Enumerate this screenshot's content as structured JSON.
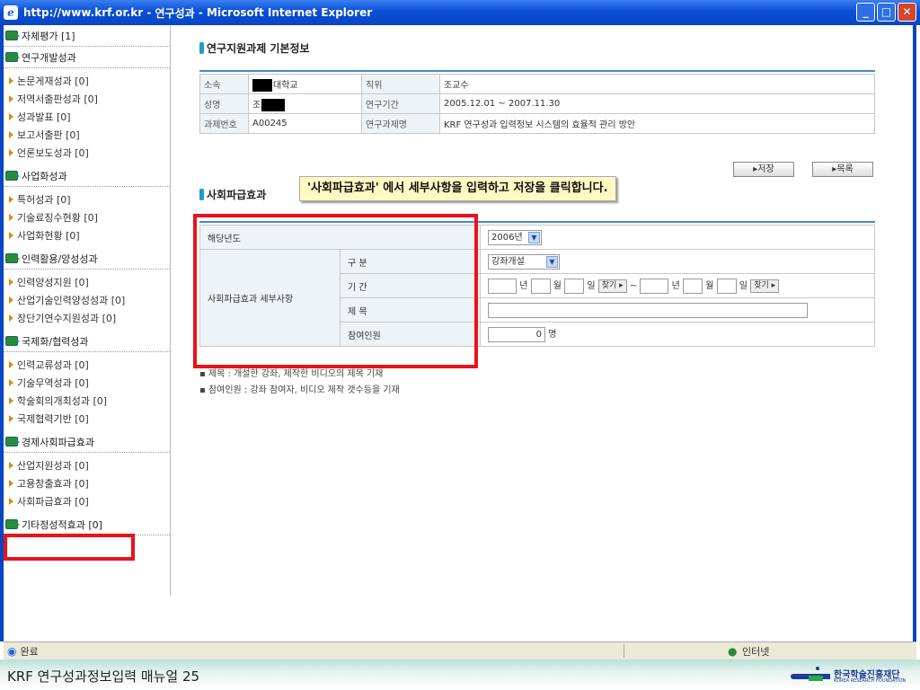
{
  "window": {
    "url": "http://www.krf.or.kr",
    "title_sep": " - ",
    "page": "연구성과",
    "app": "Microsoft Internet Explorer"
  },
  "sidebar": [
    {
      "group": "자체평가 [1]",
      "items": []
    },
    {
      "group": "연구개발성과",
      "items": [
        "논문게재성과 [0]",
        "저역서출판성과 [0]",
        "성과발표 [0]",
        "보고서출판 [0]",
        "언론보도성과 [0]"
      ]
    },
    {
      "group": "사업화성과",
      "items": [
        "특허성과 [0]",
        "기술료징수현황 [0]",
        "사업화현황 [0]"
      ]
    },
    {
      "group": "인력활용/양성성과",
      "items": [
        "인력양성지원 [0]",
        "산업기술인력양성성과 [0]",
        "장단기연수지원성과 [0]"
      ]
    },
    {
      "group": "국제화/협력성과",
      "items": [
        "인력교류성과 [0]",
        "기술무역성과 [0]",
        "학술회의개최성과 [0]",
        "국제협력기반 [0]"
      ]
    },
    {
      "group": "경제사회파급효과",
      "items": [
        "산업지원성과 [0]",
        "고용창출효과 [0]",
        "사회파급효과 [0]"
      ]
    },
    {
      "group": "기타정성적효과 [0]",
      "items": []
    }
  ],
  "basic": {
    "title": "연구지원과제 기본정보",
    "rows": [
      [
        "소속",
        "대학교",
        "직위",
        "조교수"
      ],
      [
        "성명",
        "조",
        "연구기간",
        "2005.12.01 ~ 2007.11.30"
      ],
      [
        "과제번호",
        "A00245",
        "연구과제명",
        "KRF 연구성과 입력정보 시스템의 효율적 관리 방안"
      ]
    ]
  },
  "buttons": {
    "save": "▸저장",
    "list": "▸목록",
    "find": "찾기 ▸"
  },
  "social": {
    "title": "사회파급효과",
    "callout": "'사회파급효과' 에서 세부사항을 입력하고 저장을 클릭합니다.",
    "year_label": "해당년도",
    "year_value": "2006년",
    "detail_label": "사회파급효과 세부사항",
    "type_label": "구 분",
    "type_value": "강좌개설",
    "period_label": "기 간",
    "year_unit": "년",
    "month_unit": "월",
    "day_unit": "일",
    "tilde": "~",
    "subject_label": "제 목",
    "participants_label": "참여인원",
    "participants_value": "0",
    "person_unit": "명",
    "notes": [
      "▪ 제목 : 개설한 강좌, 제작한 비디오의 제목 기재",
      "▪ 참여인원 : 강좌 참여자, 비디오 제작 갯수등을 기재"
    ]
  },
  "status": {
    "left": "완료",
    "right": "인터넷"
  },
  "footer": {
    "title": "KRF 연구성과정보입력 매뉴얼 25",
    "org": "한국학술진흥재단",
    "org_en": "KOREA RESEARCH FOUNDATION"
  },
  "colors": {
    "title_bar": "#0a4fd6",
    "highlight": "#e8131b",
    "callout_bg": "#fff9c4"
  }
}
